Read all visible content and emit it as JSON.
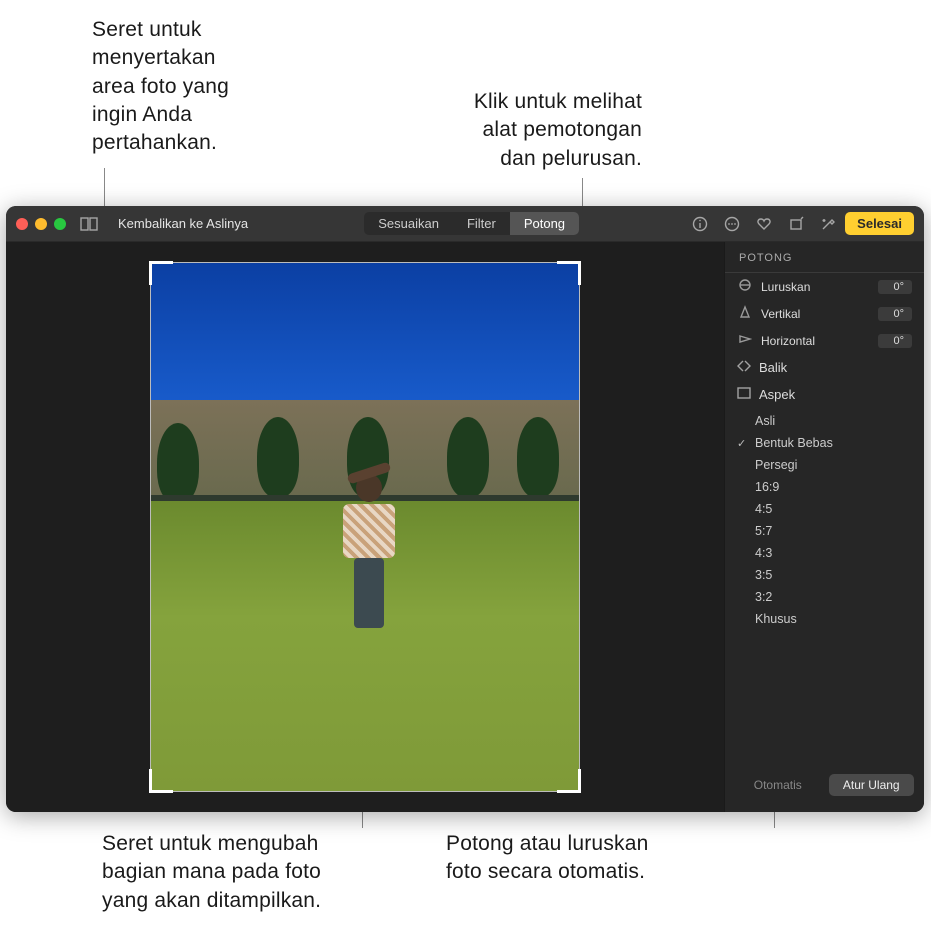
{
  "callouts": {
    "drag_include": "Seret untuk\nmenyertakan\narea foto yang\ningin Anda\npertahankan.",
    "click_tools": "Klik untuk melihat\nalat pemotongan\ndan pelurusan.",
    "drag_change": "Seret untuk mengubah\nbagian mana pada foto\nyang akan ditampilkan.",
    "auto_crop": "Potong atau luruskan\nfoto secara otomatis."
  },
  "toolbar": {
    "revert_label": "Kembalikan ke Aslinya",
    "segments": {
      "adjust": "Sesuaikan",
      "filter": "Filter",
      "crop": "Potong"
    },
    "done_label": "Selesai"
  },
  "panel": {
    "header": "POTONG",
    "sliders": {
      "straighten": {
        "label": "Luruskan",
        "value": "0°"
      },
      "vertical": {
        "label": "Vertikal",
        "value": "0°"
      },
      "horizontal": {
        "label": "Horizontal",
        "value": "0°"
      }
    },
    "flip_label": "Balik",
    "aspect_label": "Aspek",
    "aspects": [
      {
        "label": "Asli",
        "selected": false
      },
      {
        "label": "Bentuk Bebas",
        "selected": true
      },
      {
        "label": "Persegi",
        "selected": false
      },
      {
        "label": "16:9",
        "selected": false
      },
      {
        "label": "4:5",
        "selected": false
      },
      {
        "label": "5:7",
        "selected": false
      },
      {
        "label": "4:3",
        "selected": false
      },
      {
        "label": "3:5",
        "selected": false
      },
      {
        "label": "3:2",
        "selected": false
      },
      {
        "label": "Khusus",
        "selected": false
      }
    ],
    "footer": {
      "auto": "Otomatis",
      "reset": "Atur Ulang"
    }
  }
}
